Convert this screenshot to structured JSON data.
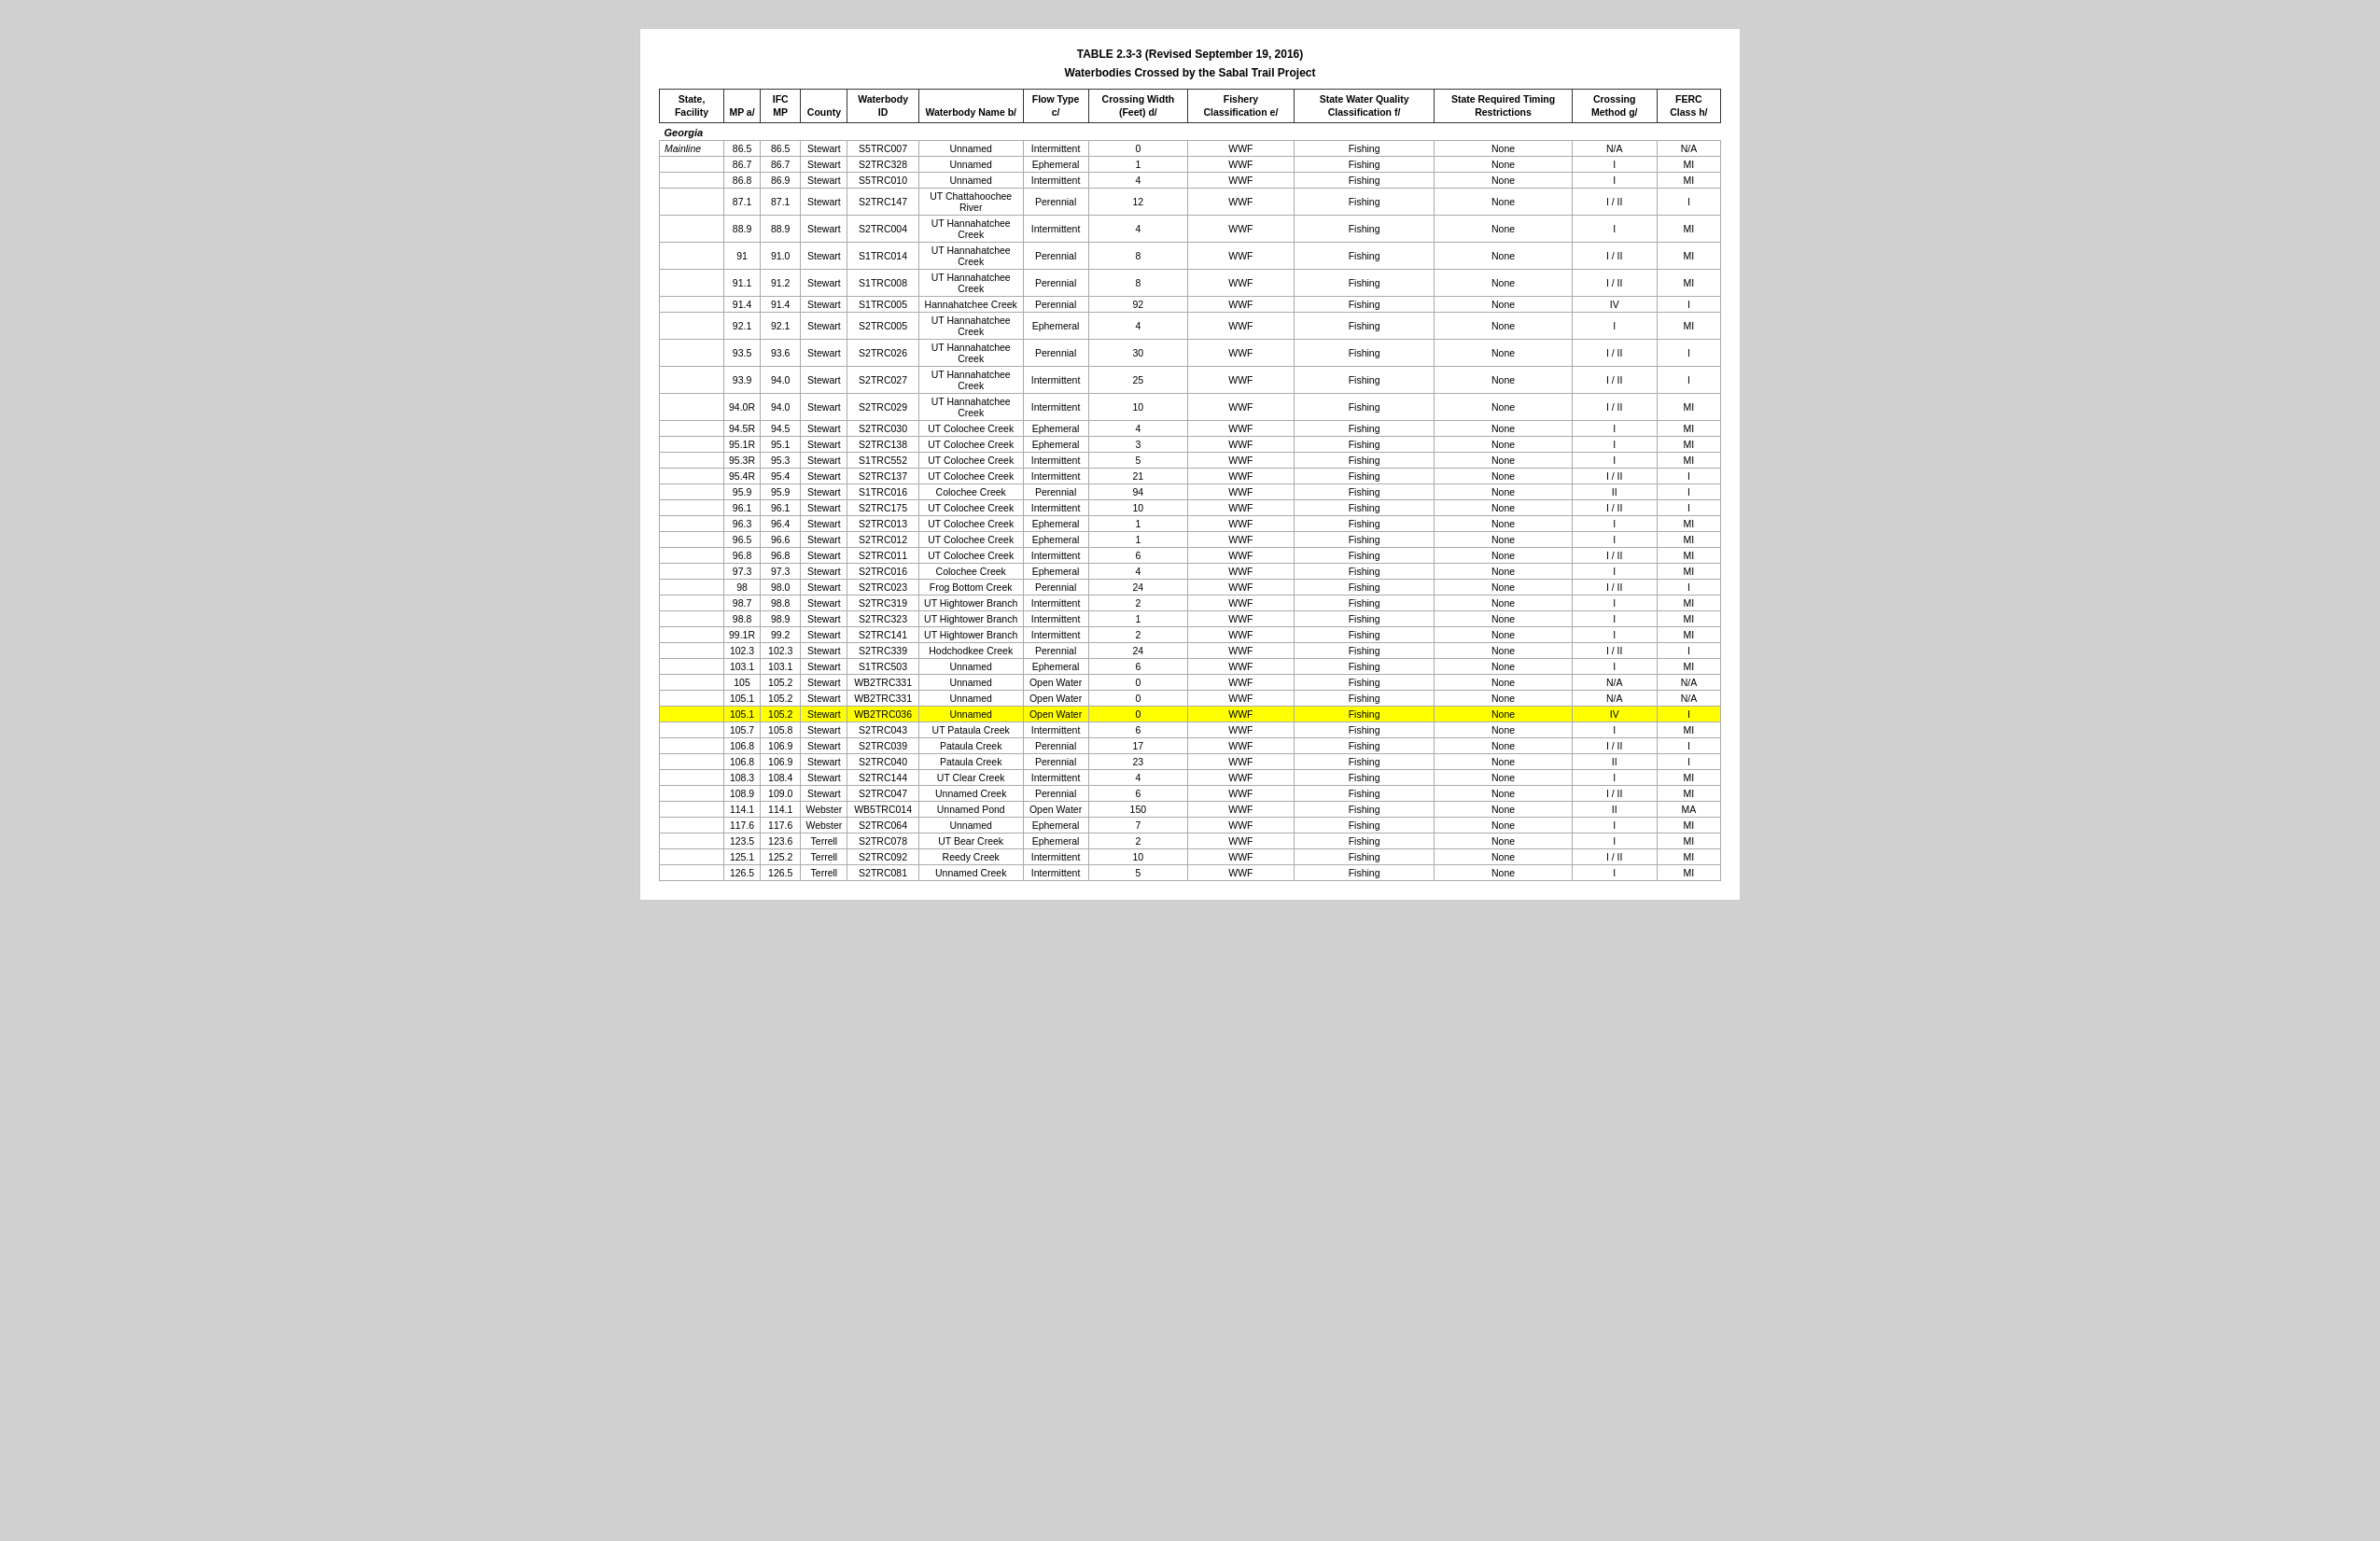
{
  "title": "TABLE 2.3-3 (Revised September 19, 2016)",
  "subtitle": "Waterbodies Crossed by the Sabal Trail Project",
  "headers": {
    "state_facility": "State, Facility",
    "mp": "MP a/",
    "ifc_mp": "IFC MP",
    "county": "County",
    "waterbody_id": "Waterbody ID",
    "waterbody_name": "Waterbody Name b/",
    "flow_type": "Flow Type c/",
    "crossing_width": "Crossing Width (Feet) d/",
    "fishery": "Fishery Classification e/",
    "state_water_quality": "State Water Quality Classification f/",
    "state_required": "State Required Timing Restrictions",
    "crossing_method": "Crossing Method g/",
    "ferc_class": "FERC Class h/"
  },
  "sections": [
    {
      "name": "Georgia",
      "subsections": [
        {
          "name": "Mainline",
          "rows": [
            {
              "mp": "86.5",
              "ifc_mp": "86.5",
              "county": "Stewart",
              "id": "S5TRC007",
              "name": "Unnamed",
              "flow": "Intermittent",
              "width": "0",
              "fishery": "WWF",
              "quality": "Fishing",
              "timing": "None",
              "method": "N/A",
              "ferc": "N/A"
            },
            {
              "mp": "86.7",
              "ifc_mp": "86.7",
              "county": "Stewart",
              "id": "S2TRC328",
              "name": "Unnamed",
              "flow": "Ephemeral",
              "width": "1",
              "fishery": "WWF",
              "quality": "Fishing",
              "timing": "None",
              "method": "I",
              "ferc": "MI"
            },
            {
              "mp": "86.8",
              "ifc_mp": "86.9",
              "county": "Stewart",
              "id": "S5TRC010",
              "name": "Unnamed",
              "flow": "Intermittent",
              "width": "4",
              "fishery": "WWF",
              "quality": "Fishing",
              "timing": "None",
              "method": "I",
              "ferc": "MI"
            },
            {
              "mp": "87.1",
              "ifc_mp": "87.1",
              "county": "Stewart",
              "id": "S2TRC147",
              "name": "UT Chattahoochee River",
              "flow": "Perennial",
              "width": "12",
              "fishery": "WWF",
              "quality": "Fishing",
              "timing": "None",
              "method": "I / II",
              "ferc": "I"
            },
            {
              "mp": "88.9",
              "ifc_mp": "88.9",
              "county": "Stewart",
              "id": "S2TRC004",
              "name": "UT Hannahatchee Creek",
              "flow": "Intermittent",
              "width": "4",
              "fishery": "WWF",
              "quality": "Fishing",
              "timing": "None",
              "method": "I",
              "ferc": "MI"
            },
            {
              "mp": "91",
              "ifc_mp": "91.0",
              "county": "Stewart",
              "id": "S1TRC014",
              "name": "UT Hannahatchee Creek",
              "flow": "Perennial",
              "width": "8",
              "fishery": "WWF",
              "quality": "Fishing",
              "timing": "None",
              "method": "I / II",
              "ferc": "MI"
            },
            {
              "mp": "91.1",
              "ifc_mp": "91.2",
              "county": "Stewart",
              "id": "S1TRC008",
              "name": "UT Hannahatchee Creek",
              "flow": "Perennial",
              "width": "8",
              "fishery": "WWF",
              "quality": "Fishing",
              "timing": "None",
              "method": "I / II",
              "ferc": "MI"
            },
            {
              "mp": "91.4",
              "ifc_mp": "91.4",
              "county": "Stewart",
              "id": "S1TRC005",
              "name": "Hannahatchee Creek",
              "flow": "Perennial",
              "width": "92",
              "fishery": "WWF",
              "quality": "Fishing",
              "timing": "None",
              "method": "IV",
              "ferc": "I"
            },
            {
              "mp": "92.1",
              "ifc_mp": "92.1",
              "county": "Stewart",
              "id": "S2TRC005",
              "name": "UT Hannahatchee Creek",
              "flow": "Ephemeral",
              "width": "4",
              "fishery": "WWF",
              "quality": "Fishing",
              "timing": "None",
              "method": "I",
              "ferc": "MI"
            },
            {
              "mp": "93.5",
              "ifc_mp": "93.6",
              "county": "Stewart",
              "id": "S2TRC026",
              "name": "UT Hannahatchee Creek",
              "flow": "Perennial",
              "width": "30",
              "fishery": "WWF",
              "quality": "Fishing",
              "timing": "None",
              "method": "I / II",
              "ferc": "I"
            },
            {
              "mp": "93.9",
              "ifc_mp": "94.0",
              "county": "Stewart",
              "id": "S2TRC027",
              "name": "UT Hannahatchee Creek",
              "flow": "Intermittent",
              "width": "25",
              "fishery": "WWF",
              "quality": "Fishing",
              "timing": "None",
              "method": "I / II",
              "ferc": "I"
            },
            {
              "mp": "94.0R",
              "ifc_mp": "94.0",
              "county": "Stewart",
              "id": "S2TRC029",
              "name": "UT Hannahatchee Creek",
              "flow": "Intermittent",
              "width": "10",
              "fishery": "WWF",
              "quality": "Fishing",
              "timing": "None",
              "method": "I / II",
              "ferc": "MI"
            },
            {
              "mp": "94.5R",
              "ifc_mp": "94.5",
              "county": "Stewart",
              "id": "S2TRC030",
              "name": "UT Colochee Creek",
              "flow": "Ephemeral",
              "width": "4",
              "fishery": "WWF",
              "quality": "Fishing",
              "timing": "None",
              "method": "I",
              "ferc": "MI"
            },
            {
              "mp": "95.1R",
              "ifc_mp": "95.1",
              "county": "Stewart",
              "id": "S2TRC138",
              "name": "UT Colochee Creek",
              "flow": "Ephemeral",
              "width": "3",
              "fishery": "WWF",
              "quality": "Fishing",
              "timing": "None",
              "method": "I",
              "ferc": "MI"
            },
            {
              "mp": "95.3R",
              "ifc_mp": "95.3",
              "county": "Stewart",
              "id": "S1TRC552",
              "name": "UT Colochee Creek",
              "flow": "Intermittent",
              "width": "5",
              "fishery": "WWF",
              "quality": "Fishing",
              "timing": "None",
              "method": "I",
              "ferc": "MI"
            },
            {
              "mp": "95.4R",
              "ifc_mp": "95.4",
              "county": "Stewart",
              "id": "S2TRC137",
              "name": "UT Colochee Creek",
              "flow": "Intermittent",
              "width": "21",
              "fishery": "WWF",
              "quality": "Fishing",
              "timing": "None",
              "method": "I / II",
              "ferc": "I"
            },
            {
              "mp": "95.9",
              "ifc_mp": "95.9",
              "county": "Stewart",
              "id": "S1TRC016",
              "name": "Colochee Creek",
              "flow": "Perennial",
              "width": "94",
              "fishery": "WWF",
              "quality": "Fishing",
              "timing": "None",
              "method": "II",
              "ferc": "I"
            },
            {
              "mp": "96.1",
              "ifc_mp": "96.1",
              "county": "Stewart",
              "id": "S2TRC175",
              "name": "UT Colochee Creek",
              "flow": "Intermittent",
              "width": "10",
              "fishery": "WWF",
              "quality": "Fishing",
              "timing": "None",
              "method": "I / II",
              "ferc": "I"
            },
            {
              "mp": "96.3",
              "ifc_mp": "96.4",
              "county": "Stewart",
              "id": "S2TRC013",
              "name": "UT Colochee Creek",
              "flow": "Ephemeral",
              "width": "1",
              "fishery": "WWF",
              "quality": "Fishing",
              "timing": "None",
              "method": "I",
              "ferc": "MI"
            },
            {
              "mp": "96.5",
              "ifc_mp": "96.6",
              "county": "Stewart",
              "id": "S2TRC012",
              "name": "UT Colochee Creek",
              "flow": "Ephemeral",
              "width": "1",
              "fishery": "WWF",
              "quality": "Fishing",
              "timing": "None",
              "method": "I",
              "ferc": "MI"
            },
            {
              "mp": "96.8",
              "ifc_mp": "96.8",
              "county": "Stewart",
              "id": "S2TRC011",
              "name": "UT Colochee Creek",
              "flow": "Intermittent",
              "width": "6",
              "fishery": "WWF",
              "quality": "Fishing",
              "timing": "None",
              "method": "I / II",
              "ferc": "MI"
            },
            {
              "mp": "97.3",
              "ifc_mp": "97.3",
              "county": "Stewart",
              "id": "S2TRC016",
              "name": "Colochee Creek",
              "flow": "Ephemeral",
              "width": "4",
              "fishery": "WWF",
              "quality": "Fishing",
              "timing": "None",
              "method": "I",
              "ferc": "MI"
            },
            {
              "mp": "98",
              "ifc_mp": "98.0",
              "county": "Stewart",
              "id": "S2TRC023",
              "name": "Frog Bottom Creek",
              "flow": "Perennial",
              "width": "24",
              "fishery": "WWF",
              "quality": "Fishing",
              "timing": "None",
              "method": "I / II",
              "ferc": "I"
            },
            {
              "mp": "98.7",
              "ifc_mp": "98.8",
              "county": "Stewart",
              "id": "S2TRC319",
              "name": "UT Hightower Branch",
              "flow": "Intermittent",
              "width": "2",
              "fishery": "WWF",
              "quality": "Fishing",
              "timing": "None",
              "method": "I",
              "ferc": "MI"
            },
            {
              "mp": "98.8",
              "ifc_mp": "98.9",
              "county": "Stewart",
              "id": "S2TRC323",
              "name": "UT Hightower Branch",
              "flow": "Intermittent",
              "width": "1",
              "fishery": "WWF",
              "quality": "Fishing",
              "timing": "None",
              "method": "I",
              "ferc": "MI"
            },
            {
              "mp": "99.1R",
              "ifc_mp": "99.2",
              "county": "Stewart",
              "id": "S2TRC141",
              "name": "UT Hightower Branch",
              "flow": "Intermittent",
              "width": "2",
              "fishery": "WWF",
              "quality": "Fishing",
              "timing": "None",
              "method": "I",
              "ferc": "MI"
            },
            {
              "mp": "102.3",
              "ifc_mp": "102.3",
              "county": "Stewart",
              "id": "S2TRC339",
              "name": "Hodchodkee Creek",
              "flow": "Perennial",
              "width": "24",
              "fishery": "WWF",
              "quality": "Fishing",
              "timing": "None",
              "method": "I / II",
              "ferc": "I"
            },
            {
              "mp": "103.1",
              "ifc_mp": "103.1",
              "county": "Stewart",
              "id": "S1TRC503",
              "name": "Unnamed",
              "flow": "Ephemeral",
              "width": "6",
              "fishery": "WWF",
              "quality": "Fishing",
              "timing": "None",
              "method": "I",
              "ferc": "MI"
            },
            {
              "mp": "105",
              "ifc_mp": "105.2",
              "county": "Stewart",
              "id": "WB2TRC331",
              "name": "Unnamed",
              "flow": "Open Water",
              "width": "0",
              "fishery": "WWF",
              "quality": "Fishing",
              "timing": "None",
              "method": "N/A",
              "ferc": "N/A"
            },
            {
              "mp": "105.1",
              "ifc_mp": "105.2",
              "county": "Stewart",
              "id": "WB2TRC331",
              "name": "Unnamed",
              "flow": "Open Water",
              "width": "0",
              "fishery": "WWF",
              "quality": "Fishing",
              "timing": "None",
              "method": "N/A",
              "ferc": "N/A"
            },
            {
              "mp": "105.1",
              "ifc_mp": "105.2",
              "county": "Stewart",
              "id": "WB2TRC036",
              "name": "Unnamed",
              "flow": "Open Water",
              "width": "0",
              "fishery": "WWF",
              "quality": "Fishing",
              "timing": "None",
              "method": "IV",
              "ferc": "I",
              "highlight": true
            },
            {
              "mp": "105.7",
              "ifc_mp": "105.8",
              "county": "Stewart",
              "id": "S2TRC043",
              "name": "UT Pataula Creek",
              "flow": "Intermittent",
              "width": "6",
              "fishery": "WWF",
              "quality": "Fishing",
              "timing": "None",
              "method": "I",
              "ferc": "MI"
            },
            {
              "mp": "106.8",
              "ifc_mp": "106.9",
              "county": "Stewart",
              "id": "S2TRC039",
              "name": "Pataula Creek",
              "flow": "Perennial",
              "width": "17",
              "fishery": "WWF",
              "quality": "Fishing",
              "timing": "None",
              "method": "I / II",
              "ferc": "I"
            },
            {
              "mp": "106.8",
              "ifc_mp": "106.9",
              "county": "Stewart",
              "id": "S2TRC040",
              "name": "Pataula Creek",
              "flow": "Perennial",
              "width": "23",
              "fishery": "WWF",
              "quality": "Fishing",
              "timing": "None",
              "method": "II",
              "ferc": "I"
            },
            {
              "mp": "108.3",
              "ifc_mp": "108.4",
              "county": "Stewart",
              "id": "S2TRC144",
              "name": "UT Clear Creek",
              "flow": "Intermittent",
              "width": "4",
              "fishery": "WWF",
              "quality": "Fishing",
              "timing": "None",
              "method": "I",
              "ferc": "MI"
            },
            {
              "mp": "108.9",
              "ifc_mp": "109.0",
              "county": "Stewart",
              "id": "S2TRC047",
              "name": "Unnamed Creek",
              "flow": "Perennial",
              "width": "6",
              "fishery": "WWF",
              "quality": "Fishing",
              "timing": "None",
              "method": "I / II",
              "ferc": "MI"
            },
            {
              "mp": "114.1",
              "ifc_mp": "114.1",
              "county": "Webster",
              "id": "WB5TRC014",
              "name": "Unnamed Pond",
              "flow": "Open Water",
              "width": "150",
              "fishery": "WWF",
              "quality": "Fishing",
              "timing": "None",
              "method": "II",
              "ferc": "MA"
            },
            {
              "mp": "117.6",
              "ifc_mp": "117.6",
              "county": "Webster",
              "id": "S2TRC064",
              "name": "Unnamed",
              "flow": "Ephemeral",
              "width": "7",
              "fishery": "WWF",
              "quality": "Fishing",
              "timing": "None",
              "method": "I",
              "ferc": "MI"
            },
            {
              "mp": "123.5",
              "ifc_mp": "123.6",
              "county": "Terrell",
              "id": "S2TRC078",
              "name": "UT Bear Creek",
              "flow": "Ephemeral",
              "width": "2",
              "fishery": "WWF",
              "quality": "Fishing",
              "timing": "None",
              "method": "I",
              "ferc": "MI"
            },
            {
              "mp": "125.1",
              "ifc_mp": "125.2",
              "county": "Terrell",
              "id": "S2TRC092",
              "name": "Reedy Creek",
              "flow": "Intermittent",
              "width": "10",
              "fishery": "WWF",
              "quality": "Fishing",
              "timing": "None",
              "method": "I / II",
              "ferc": "MI"
            },
            {
              "mp": "126.5",
              "ifc_mp": "126.5",
              "county": "Terrell",
              "id": "S2TRC081",
              "name": "Unnamed Creek",
              "flow": "Intermittent",
              "width": "5",
              "fishery": "WWF",
              "quality": "Fishing",
              "timing": "None",
              "method": "I",
              "ferc": "MI"
            }
          ]
        }
      ]
    }
  ]
}
